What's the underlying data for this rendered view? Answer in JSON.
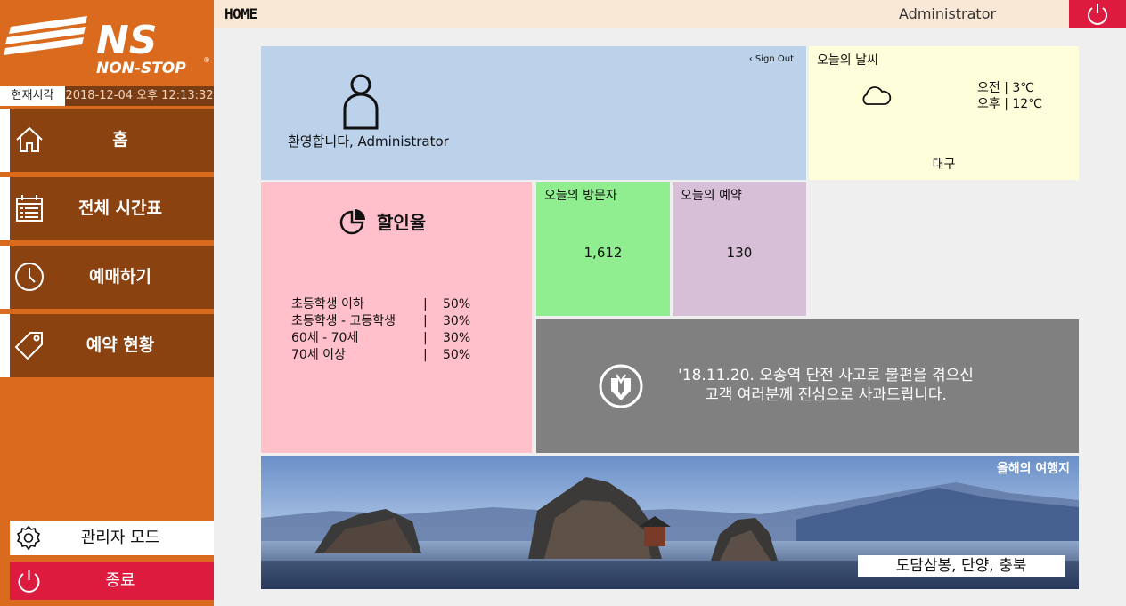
{
  "brand": {
    "logo_mark": "NS",
    "logo_text": "NON-STOP",
    "registered": "®"
  },
  "clock": {
    "label": "현재시각",
    "value": "2018-12-04 오후 12:13:32"
  },
  "sidebar": {
    "items": [
      {
        "label": "홈",
        "icon": "home-icon"
      },
      {
        "label": "전체 시간표",
        "icon": "calendar-icon"
      },
      {
        "label": "예매하기",
        "icon": "clock-icon"
      },
      {
        "label": "예약 현황",
        "icon": "tag-icon"
      }
    ],
    "admin_mode": "관리자 모드",
    "quit": "종료"
  },
  "topbar": {
    "title": "HOME",
    "user": "Administrator"
  },
  "welcome": {
    "sign_out": "Sign Out",
    "greeting": "환영합니다, Administrator"
  },
  "weather": {
    "title": "오늘의 날씨",
    "am": "오전 |   3℃",
    "pm": "오후 | 12℃",
    "city": "대구"
  },
  "discount": {
    "title": "할인율",
    "rows": [
      {
        "group": "초등학생 이하",
        "sep": "|",
        "rate": "50%"
      },
      {
        "group": "초등학생 - 고등학생",
        "sep": "|",
        "rate": "30%"
      },
      {
        "group": "60세 - 70세",
        "sep": "|",
        "rate": "30%"
      },
      {
        "group": "70세 이상",
        "sep": "|",
        "rate": "50%"
      }
    ]
  },
  "visitors": {
    "title": "오늘의 방문자",
    "value": "1,612"
  },
  "reservations": {
    "title": "오늘의 예약",
    "value": "130"
  },
  "notice": {
    "line1": "'18.11.20. 오송역 단전 사고로 불편을 겪으신",
    "line2": "고객 여러분께 진심으로 사과드립니다."
  },
  "travel": {
    "title": "올해의 여행지",
    "place": "도담삼봉, 단양, 충북"
  },
  "colors": {
    "sidebar": "#d96a1e",
    "menu": "#8a4310",
    "danger": "#dc1b3e",
    "welcome": "#bcd1ea",
    "weather": "#fffedb",
    "discount": "#ffc0cb",
    "visitors": "#90ee90",
    "reservations": "#d8bfd8",
    "notice": "#808080"
  }
}
